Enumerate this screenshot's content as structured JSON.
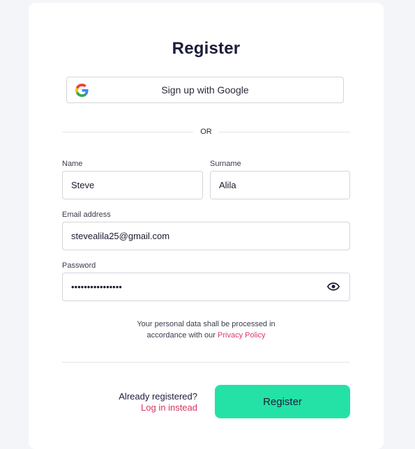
{
  "title": "Register",
  "google_button": {
    "label": "Sign up with Google",
    "icon": "google-icon"
  },
  "separator": {
    "label": "OR"
  },
  "name_field": {
    "label": "Name",
    "value": "Steve"
  },
  "surname_field": {
    "label": "Surname",
    "value": "Alila"
  },
  "email_field": {
    "label": "Email address",
    "value": "stevealila25@gmail.com"
  },
  "password_field": {
    "label": "Password",
    "value": "supersecretpwd12",
    "toggle_icon": "eye-icon"
  },
  "privacy": {
    "line1": "Your personal data shall be processed in",
    "line2_prefix": "accordance with our ",
    "link": "Privacy Policy"
  },
  "login_prompt": {
    "question": "Already registered?",
    "link": "Log in instead"
  },
  "submit": {
    "label": "Register"
  },
  "colors": {
    "accent": "#24e2a6",
    "link": "#d8335f",
    "page_background": "#f4f5f8",
    "card_background": "#ffffff"
  }
}
